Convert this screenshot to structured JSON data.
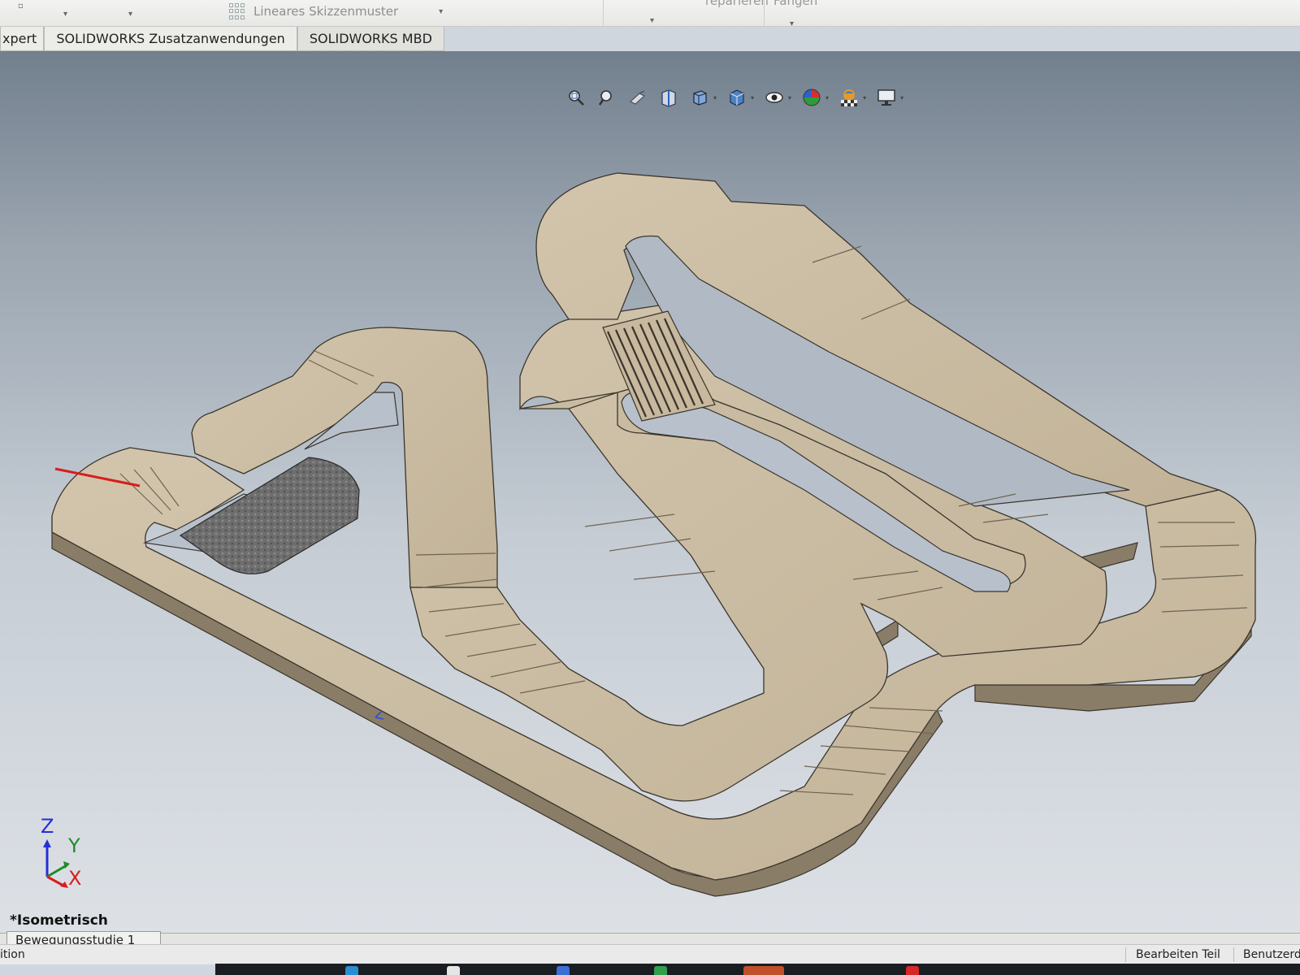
{
  "ribbon": {
    "sketch_pattern_label": "Lineares Skizzenmuster",
    "repair_label": "reparieren",
    "snap_label": "Fangen"
  },
  "tabs": [
    {
      "label": "xpert"
    },
    {
      "label": "SOLIDWORKS Zusatzanwendungen"
    },
    {
      "label": "SOLIDWORKS MBD"
    }
  ],
  "heads_up_toolbar": [
    {
      "icon": "zoom-to-fit-icon"
    },
    {
      "icon": "zoom-to-area-icon"
    },
    {
      "icon": "previous-view-icon"
    },
    {
      "icon": "section-view-icon"
    },
    {
      "icon": "view-orientation-icon"
    },
    {
      "icon": "display-style-icon"
    },
    {
      "icon": "hide-show-items-icon"
    },
    {
      "icon": "edit-appearance-icon"
    },
    {
      "icon": "apply-scene-icon"
    },
    {
      "icon": "view-settings-icon"
    }
  ],
  "viewport": {
    "view_name": "*Isometrisch",
    "triad": {
      "z": "Z",
      "y": "Y",
      "x": "X"
    }
  },
  "motion_study_tab": "Bewegungsstudie 1",
  "status_bar": {
    "left_text": "ition",
    "edit_mode": "Bearbeiten Teil",
    "user_defined": "Benutzerd"
  },
  "colors": {
    "track_top": "#cbbda4",
    "track_wall": "#8c7f69",
    "track_outline": "#3b352d",
    "textured_area": "#6b6b6b",
    "triad_x": "#d81d1d",
    "triad_y": "#1f8a2a",
    "triad_z": "#2430d6"
  }
}
